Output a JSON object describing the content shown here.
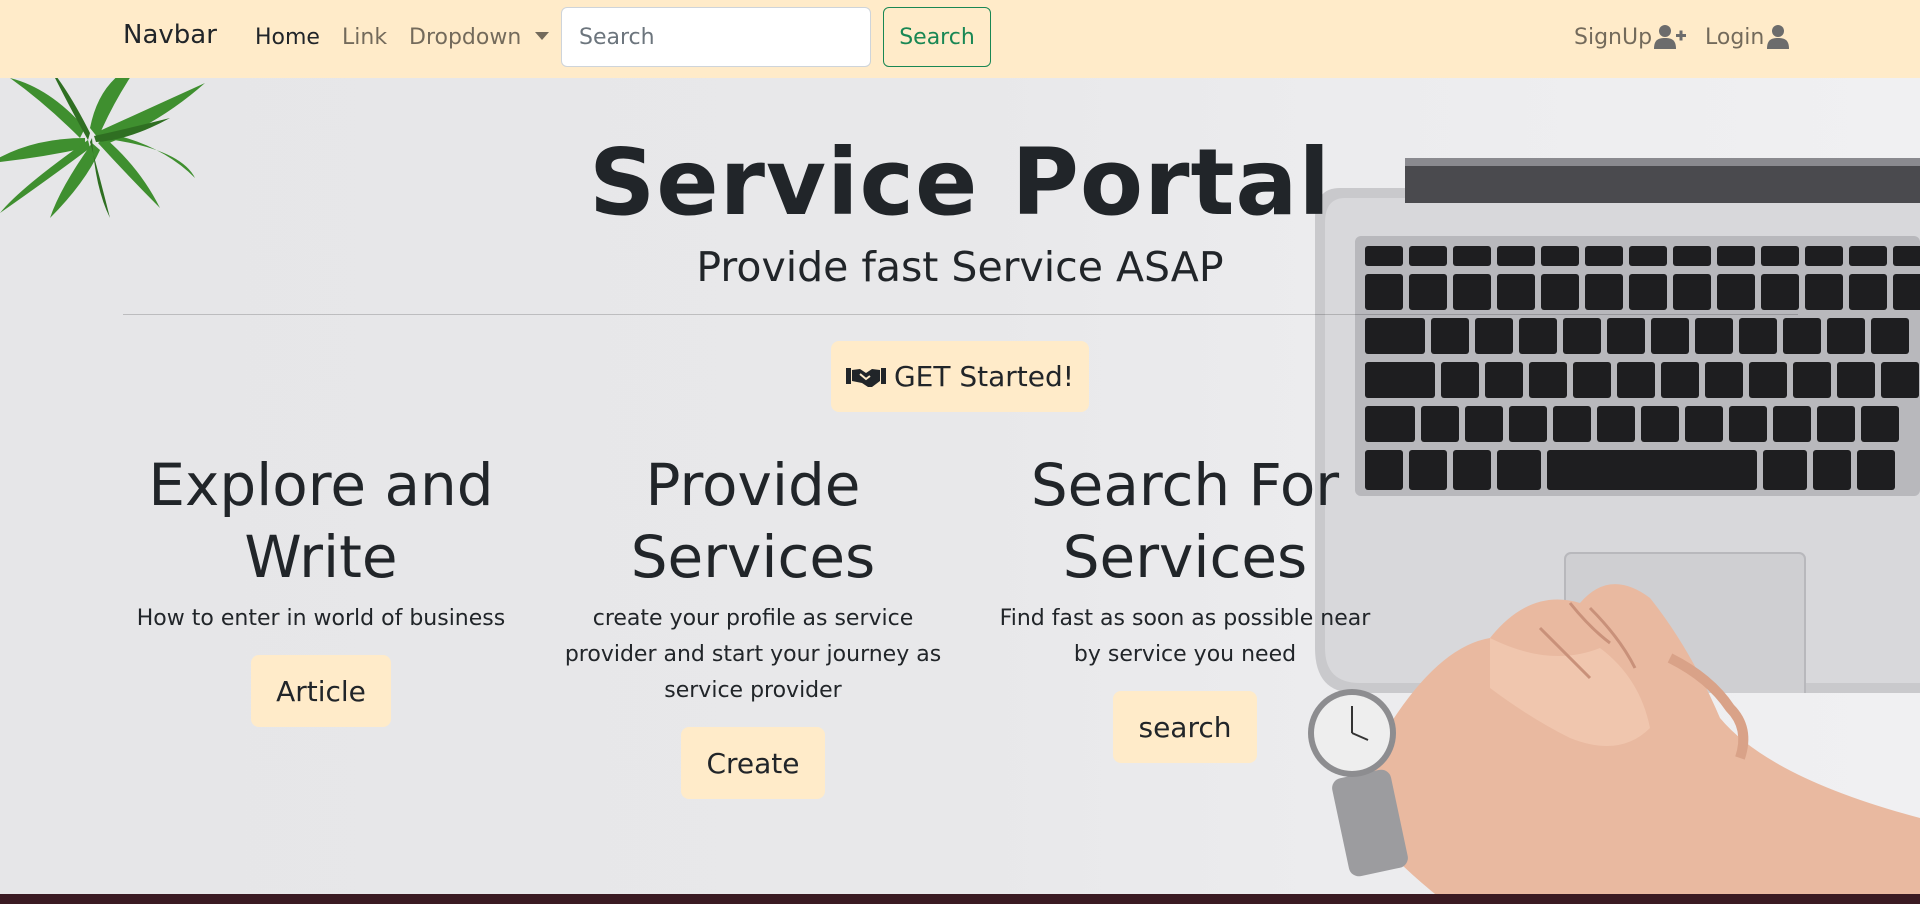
{
  "navbar": {
    "brand": "Navbar",
    "links": {
      "home": "Home",
      "link": "Link",
      "dropdown": "Dropdown"
    },
    "search": {
      "placeholder": "Search",
      "button": "Search"
    },
    "signup": "SignUp",
    "login": "Login"
  },
  "hero": {
    "title": "Service Portal",
    "subtitle": "Provide fast Service ASAP",
    "cta": "GET Started!"
  },
  "columns": [
    {
      "title": "Explore and Write",
      "text": "How to enter in world of business",
      "button": "Article"
    },
    {
      "title": "Provide Services",
      "text": "create your profile as service provider and start your journey as service provider",
      "button": "Create"
    },
    {
      "title": "Search For Services",
      "text": "Find fast as soon as possible near by service you need",
      "button": "search"
    }
  ],
  "icons": {
    "signup": "user-plus-icon",
    "login": "user-icon",
    "cta": "handshake-icon",
    "dropdown": "caret-down-icon"
  },
  "colors": {
    "navbar_bg": "#ffebc9",
    "button_bg": "#ffebc9",
    "search_button": "#198754",
    "text": "#212529"
  }
}
